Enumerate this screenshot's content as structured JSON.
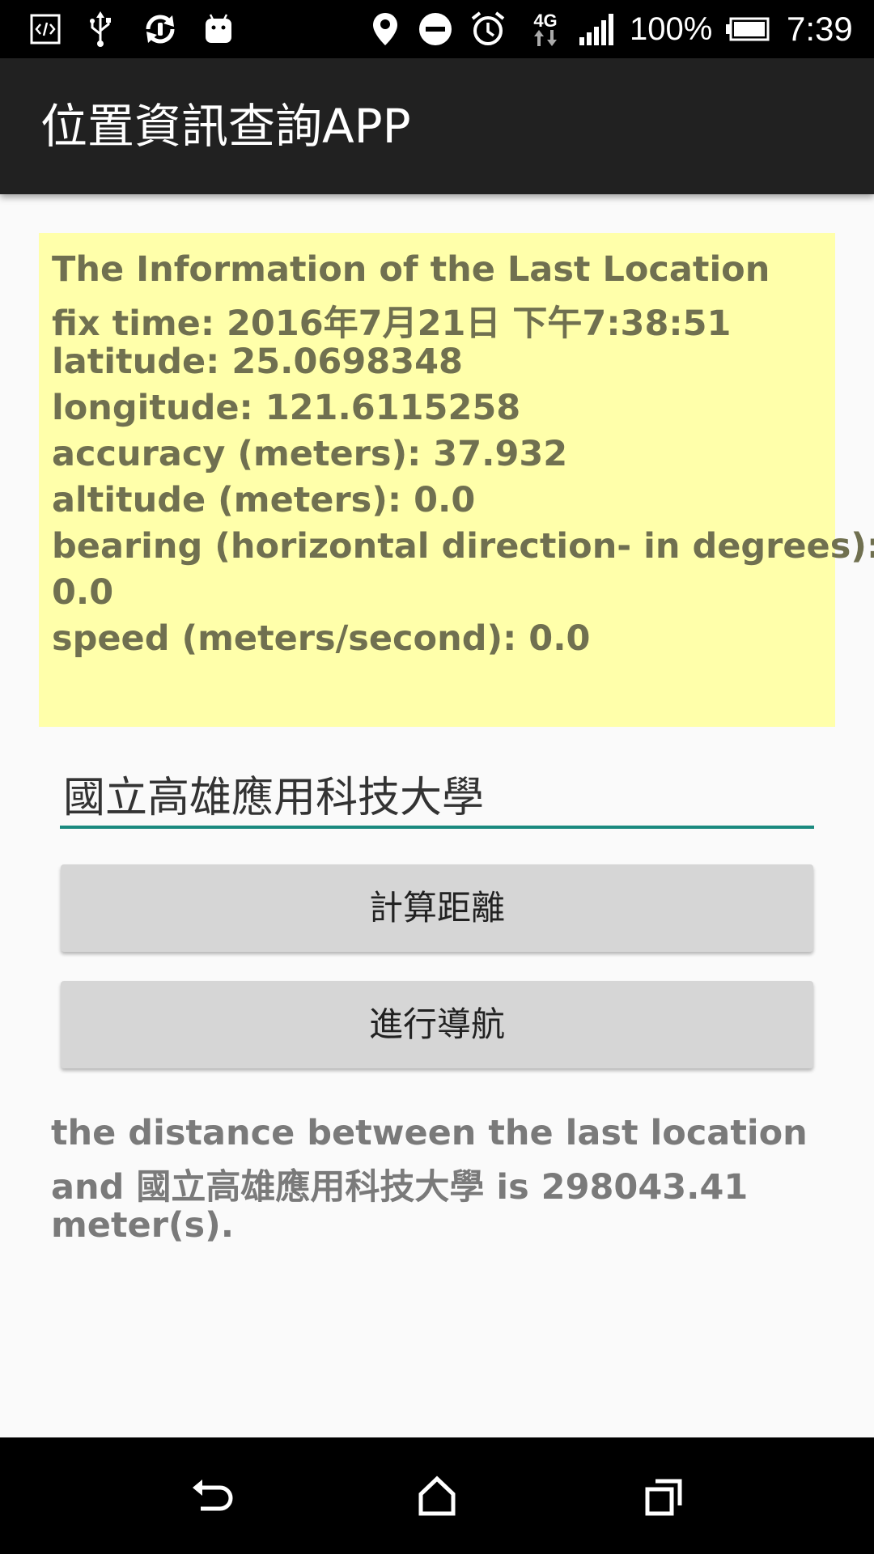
{
  "status_bar": {
    "battery": "100%",
    "time": "7:39",
    "network": "4G",
    "icons": [
      "code-icon",
      "usb-icon",
      "sync-icon",
      "android-icon",
      "location-icon",
      "do-not-disturb-icon",
      "alarm-icon",
      "network-4g-icon",
      "signal-icon",
      "battery-icon"
    ]
  },
  "app_bar": {
    "title": "位置資訊查詢APP"
  },
  "location_info": {
    "lines": [
      "The Information of the Last Location",
      "fix time: 2016年7月21日 下午7:38:51",
      "latitude: 25.0698348",
      "longitude: 121.6115258",
      "accuracy (meters): 37.932",
      "altitude (meters): 0.0",
      "bearing (horizontal direction- in degrees):",
      "0.0",
      "speed (meters/second): 0.0"
    ]
  },
  "destination": {
    "value": "國立高雄應用科技大學"
  },
  "buttons": {
    "calculate_distance": "計算距離",
    "navigate": "進行導航"
  },
  "result": {
    "lines": [
      "the distance between the last location",
      "and 國立高雄應用科技大學 is 298043.41",
      "meter(s)."
    ]
  },
  "nav_bar": {
    "icons": [
      "back-icon",
      "home-icon",
      "recents-icon"
    ]
  },
  "colors": {
    "status_bar": "#000000",
    "app_bar": "#212121",
    "info_background": "#ffffaa",
    "info_text": "#707050",
    "input_underline": "#1a8a7f",
    "button": "#d6d6d6",
    "result_text": "#7a7a7a",
    "background": "#fafafa"
  }
}
